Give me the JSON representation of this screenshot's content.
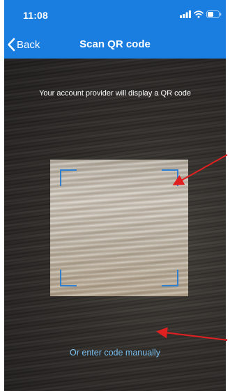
{
  "status_bar": {
    "time": "11:08",
    "icons": [
      "signal-bars-icon",
      "wifi-icon",
      "battery-icon"
    ]
  },
  "nav": {
    "back_label": "Back",
    "back_icon": "chevron-left-icon",
    "title": "Scan QR code"
  },
  "scanner": {
    "instruction": "Your account provider will display a QR code",
    "manual_link": "Or enter code manually"
  },
  "colors": {
    "header_bg": "#1a7de0",
    "frame_corners": "#2f7fd0",
    "link": "#7cc0f0",
    "annotation_arrow": "#e02020"
  }
}
